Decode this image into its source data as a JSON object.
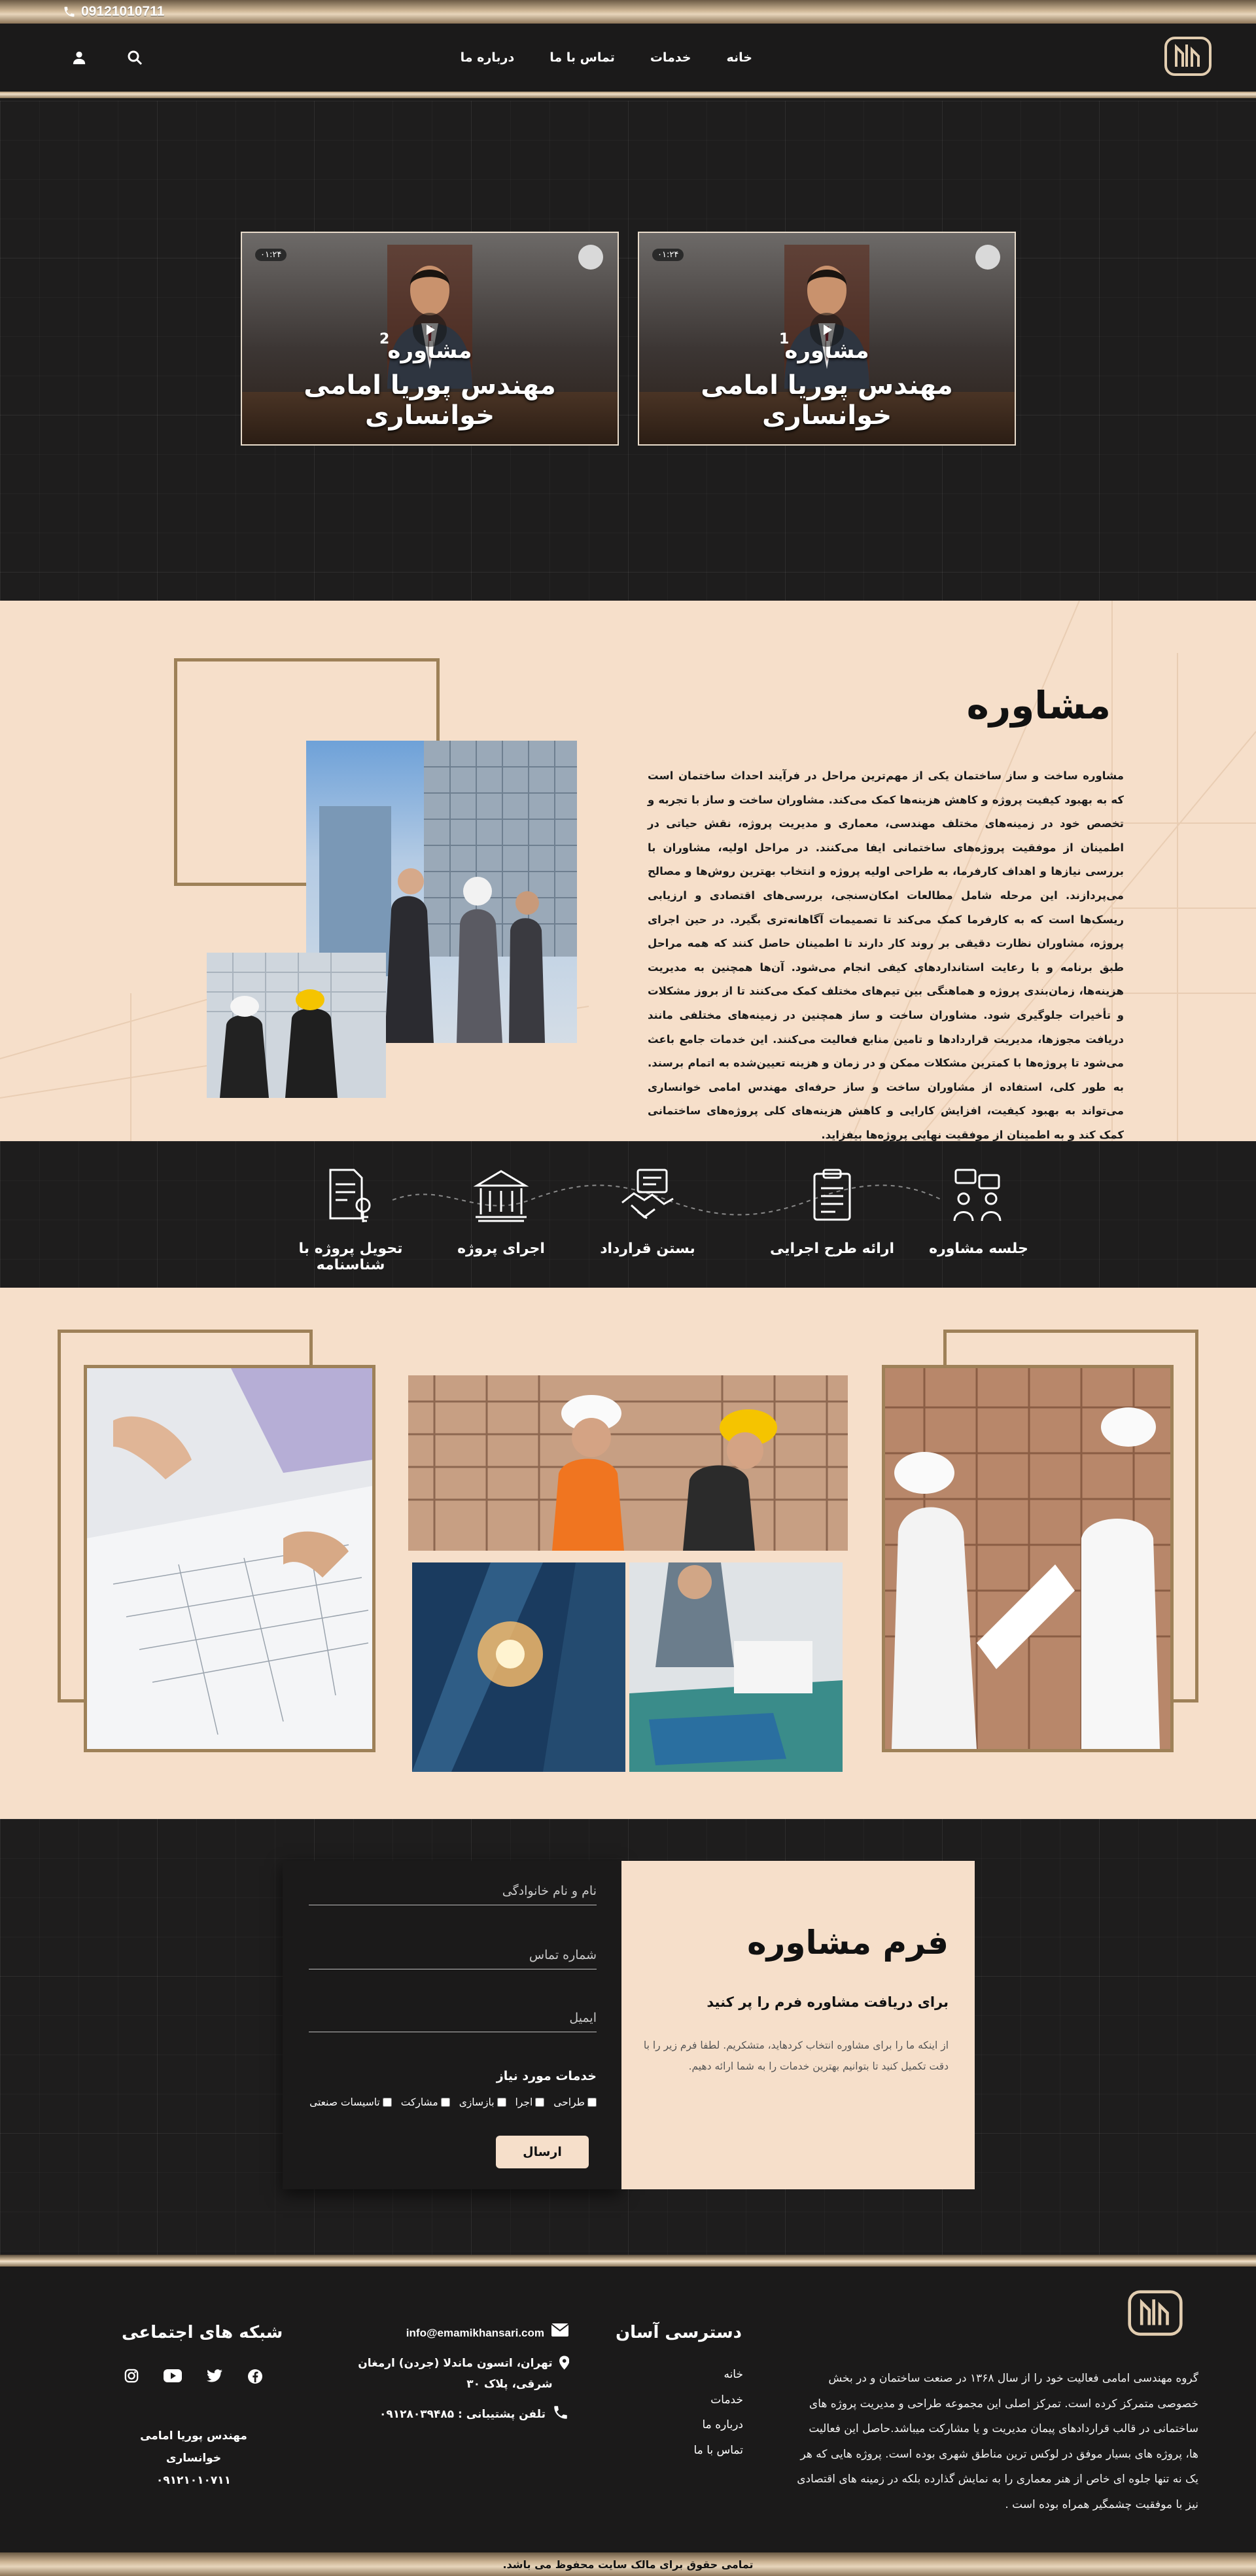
{
  "topbar": {
    "phone": "09121010711"
  },
  "nav": {
    "items": [
      "خانه",
      "خدمات",
      "تماس با ما",
      "درباره ما"
    ]
  },
  "hero": {
    "videos": [
      {
        "number": "1",
        "title_top": "مشاوره",
        "title_bottom": "مهندس پوریا امامی خوانساری",
        "duration": "۰۱:۲۴"
      },
      {
        "number": "2",
        "title_top": "مشاوره",
        "title_bottom": "مهندس پوریا امامی خوانساری",
        "duration": "۰۱:۲۴"
      }
    ]
  },
  "consult": {
    "title": "مشاوره",
    "body": "مشاوره ساخت و ساز ساختمان یکی از مهم‌ترین مراحل در فرآیند احداث ساختمان است که به بهبود کیفیت پروژه و کاهش هزینه‌ها کمک می‌کند. مشاوران ساخت و ساز با تجربه و تخصص خود در زمینه‌های مختلف مهندسی، معماری و مدیریت پروژه، نقش حیاتی در اطمینان از موفقیت پروژه‌های ساختمانی ایفا می‌کنند. در مراحل اولیه، مشاوران با بررسی نیازها و اهداف کارفرما، به طراحی اولیه پروژه و انتخاب بهترین روش‌ها و مصالح می‌پردازند. این مرحله شامل مطالعات امکان‌سنجی، بررسی‌های اقتصادی و ارزیابی ریسک‌ها است که به کارفرما کمک می‌کند تا تصمیمات آگاهانه‌تری بگیرد. در حین اجرای پروژه، مشاوران نظارت دقیقی بر روند کار دارند تا اطمینان حاصل کنند که همه مراحل طبق برنامه و با رعایت استانداردهای کیفی انجام می‌شود. آن‌ها همچنین به مدیریت هزینه‌ها، زمان‌بندی پروژه و هماهنگی بین تیم‌های مختلف کمک می‌کنند تا از بروز مشکلات و تأخیرات جلوگیری شود. مشاوران ساخت و ساز همچنین در زمینه‌های مختلفی مانند دریافت مجوزها، مدیریت قراردادها و تامین منابع فعالیت می‌کنند. این خدمات جامع باعث می‌شود تا پروژه‌ها با کمترین مشکلات ممکن و در زمان و هزینه تعیین‌شده به اتمام برسند. به طور کلی، استفاده از مشاوران ساخت و ساز حرفه‌ای مهندس امامی خوانساری می‌تواند به بهبود کیفیت، افزایش کارایی و کاهش هزینه‌های کلی پروژه‌های ساختمانی کمک کند و به اطمینان از موفقیت نهایی پروژه‌ها بیفزاید."
  },
  "process": {
    "steps": [
      "جلسه مشاوره",
      "ارائه طرح اجرایی",
      "بستن قرارداد",
      "اجرای پروژه",
      "تحویل پروژه با شناسنامه"
    ]
  },
  "form": {
    "title": "فرم مشاوره",
    "subtitle": "برای دریافت مشاوره فرم را پر کنید",
    "description": "از اینکه ما را برای مشاوره انتخاب کردهاید، متشکریم. لطفا فرم زیر را با دقت تکمیل کنید تا بتوانیم بهترین خدمات را به شما ارائه دهیم.",
    "name_placeholder": "نام و نام خانوادگی",
    "phone_placeholder": "شماره تماس",
    "email_placeholder": "ایمیل",
    "services_label": "خدمات مورد نیاز",
    "services": [
      "طراحی",
      "اجرا",
      "بازسازی",
      "مشارکت",
      "تاسیسات صنعتی"
    ],
    "submit": "ارسال"
  },
  "footer": {
    "about": "گروه مهندسی امامی فعالیت خود را از سال ۱۳۶۸ در صنعت ساختمان و در بخش خصوصی متمرکز کرده است. تمرکز اصلی این مجموعه طراحی و مدیریت پروژه های ساختمانی در قالب قراردادهای پیمان مدیریت و یا مشارکت میباشد.حاصل این فعالیت ها، پروژه های بسیار موفق در لوکس ترین مناطق شهری بوده است. پروژه هایی که هر یک نه تنها جلوه ای خاص از هنر معماری را به نمایش گذارده بلکه در زمینه های اقتصادی نیز با موفقیت چشمگیر همراه بوده است .",
    "quick_title": "دسترسی آسان",
    "quick_links": [
      "خانه",
      "خدمات",
      "درباره ما",
      "تماس با ما"
    ],
    "email": "info@emamikhansari.com",
    "address": "تهران، اتسون ماندلا (جردن) ارمغان شرقی، پلاک ۳۰",
    "phone": "تلفن پشتیبانی : ۰۹۱۲۸۰۳۹۴۸۵",
    "social_title": "شبکه های اجتماعی",
    "name": "مهندس پوریا امامی خوانساری",
    "mobile": "۰۹۱۲۱۰۱۰۷۱۱"
  },
  "copyright": "تمامی حقوق برای مالک سایت محفوظ می باشد.",
  "colors": {
    "gold": "#9e8158",
    "peach": "#f6dfca",
    "dark": "#1c1b1b"
  }
}
